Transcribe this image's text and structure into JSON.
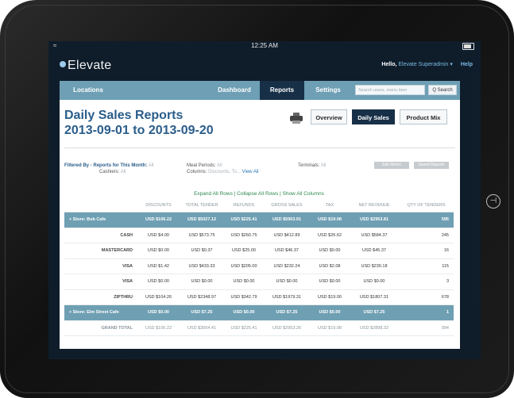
{
  "status": {
    "time": "12:25 AM"
  },
  "header": {
    "app_name": "Elevate",
    "greeting": "Hello,",
    "user": "Elevate Superadmin ▾",
    "help": "Help"
  },
  "nav": {
    "locations": "Locations",
    "dashboard": "Dashboard",
    "reports": "Reports",
    "settings": "Settings",
    "search_placeholder": "Search users, menu item",
    "search_button": "Q Search"
  },
  "page": {
    "title_line1": "Daily Sales Reports",
    "title_line2": "2013-09-01 to 2013-09-20",
    "views": [
      "Overview",
      "Daily Sales",
      "Product Mix"
    ],
    "active_view": "Daily Sales"
  },
  "filters": {
    "filtered_by_label": "Filtered By -",
    "reports_month_label": "Reports for This Month:",
    "reports_month_value": "All",
    "cashiers_label": "Cashiers:",
    "cashiers_value": "All",
    "meal_periods_label": "Meal Periods:",
    "meal_periods_value": "All",
    "columns_label": "Columns:",
    "columns_value": "Discounts, To...",
    "view_all": "View All",
    "terminals_label": "Terminals:",
    "terminals_value": "All",
    "button1": "Edit Metrix",
    "button2": "Saved Reports"
  },
  "table": {
    "expand_links": "Expand All Rows | Collapse All Rows | Show All Columns",
    "columns": [
      "",
      "DISCOUNTS",
      "TOTAL TENDER",
      "REFUNDS",
      "GROSS SALES",
      "TAX",
      "NET REVENUE",
      "QTY OF TENDERS"
    ],
    "rows": [
      {
        "type": "group",
        "cells": [
          "+ Store: Bob Cafe",
          "USD $106.22",
          "USD $5027.12",
          "USD $225.41",
          "USD $5903.91",
          "USD $19.08",
          "USD $2953.81",
          "595"
        ]
      },
      {
        "type": "row",
        "cells": [
          "CASH",
          "USD $4.00",
          "USD $573.75",
          "USD $260.75",
          "USD $412.89",
          "USD $26.62",
          "USD $584.37",
          "245"
        ]
      },
      {
        "type": "row",
        "cells": [
          "MASTERCARD",
          "USD $0.00",
          "USD $0.37",
          "USD $25.00",
          "USD $46.37",
          "USD $0.00",
          "USD $45.37",
          "16"
        ]
      },
      {
        "type": "row",
        "cells": [
          "VISA",
          "USD $1.42",
          "USD $433.33",
          "USD $205.00",
          "USD $232.24",
          "USD $2.08",
          "USD $230.18",
          "115"
        ]
      },
      {
        "type": "row",
        "cells": [
          "VISA",
          "USD $0.00",
          "USD $0.00",
          "USD $0.00",
          "USD $0.00",
          "USD $0.00",
          "USD $0.00",
          "3"
        ]
      },
      {
        "type": "row",
        "cells": [
          "ZIPTHRU",
          "USD $104.26",
          "USD $2348.97",
          "USD $342.79",
          "USD $1979.31",
          "USD $19.00",
          "USD $1807.31",
          "678"
        ]
      },
      {
        "type": "group",
        "cells": [
          "+ Store: Elm Street Cafe",
          "USD $0.00",
          "USD $7.25",
          "USD $0.00",
          "USD $7.25",
          "USD $0.00",
          "USD $7.25",
          "1"
        ]
      },
      {
        "type": "grand",
        "cells": [
          "GRAND TOTAL",
          "USD $106.22",
          "USD $3004.41",
          "USD $225.41",
          "USD $2953.26",
          "USD $19.08",
          "USD $2898.32",
          "994"
        ]
      }
    ]
  }
}
